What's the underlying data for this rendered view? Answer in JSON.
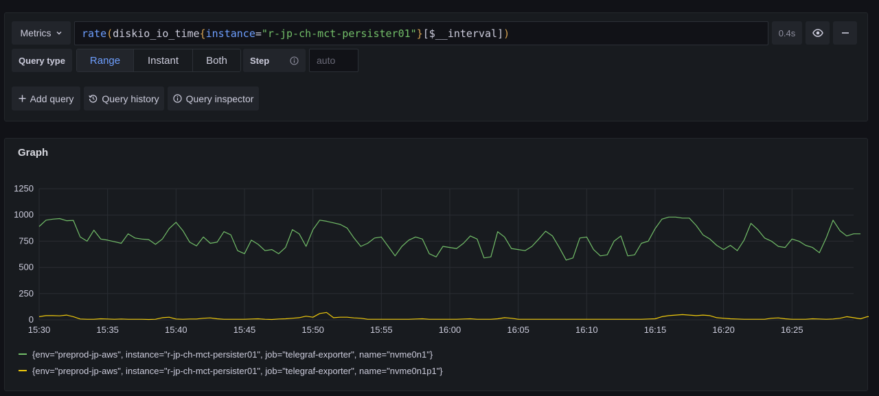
{
  "query": {
    "metrics_label": "Metrics",
    "expression_tokens": [
      {
        "text": "rate",
        "kind": "fn"
      },
      {
        "text": "(",
        "kind": "br"
      },
      {
        "text": "diskio_io_time",
        "kind": "id"
      },
      {
        "text": "{",
        "kind": "br"
      },
      {
        "text": "instance",
        "kind": "label"
      },
      {
        "text": "=",
        "kind": "id"
      },
      {
        "text": "\"r-jp-ch-mct-persister01\"",
        "kind": "str"
      },
      {
        "text": "}",
        "kind": "br"
      },
      {
        "text": "[$__interval]",
        "kind": "id"
      },
      {
        "text": ")",
        "kind": "br"
      }
    ],
    "duration": "0.4s",
    "query_type_label": "Query type",
    "query_types": [
      "Range",
      "Instant",
      "Both"
    ],
    "selected_query_type": "Range",
    "step_label": "Step",
    "step_placeholder": "auto",
    "add_query_label": "Add query",
    "history_label": "Query history",
    "inspector_label": "Query inspector"
  },
  "graph": {
    "title": "Graph"
  },
  "colors": {
    "series_green": "#73bf69",
    "series_yellow": "#f2cc0c",
    "accent_blue": "#6e9fff"
  },
  "chart_data": {
    "type": "line",
    "title": "Graph",
    "x_ticks": [
      "15:30",
      "15:35",
      "15:40",
      "15:45",
      "15:50",
      "15:55",
      "16:00",
      "16:05",
      "16:10",
      "16:15",
      "16:20",
      "16:25"
    ],
    "x_start": "15:30",
    "x_end": "16:29:30",
    "sample_interval_seconds": 30,
    "ylim": [
      0,
      1250
    ],
    "y_ticks": [
      0,
      250,
      500,
      750,
      1000,
      1250
    ],
    "grid": true,
    "legend_position": "bottom",
    "series": [
      {
        "name": "{env=\"preprod-jp-aws\", instance=\"r-jp-ch-mct-persister01\", job=\"telegraf-exporter\", name=\"nvme0n1\"}",
        "color": "#73bf69",
        "values": [
          890,
          950,
          960,
          965,
          945,
          948,
          790,
          750,
          855,
          770,
          760,
          745,
          730,
          820,
          780,
          770,
          765,
          720,
          770,
          870,
          930,
          850,
          740,
          705,
          790,
          730,
          740,
          840,
          810,
          660,
          630,
          760,
          720,
          660,
          670,
          630,
          690,
          860,
          820,
          700,
          860,
          950,
          940,
          925,
          910,
          875,
          780,
          700,
          730,
          780,
          790,
          700,
          610,
          700,
          760,
          790,
          770,
          630,
          600,
          700,
          690,
          680,
          730,
          800,
          770,
          590,
          600,
          840,
          790,
          680,
          670,
          660,
          700,
          770,
          845,
          800,
          690,
          570,
          590,
          780,
          790,
          670,
          610,
          620,
          750,
          800,
          610,
          620,
          730,
          750,
          870,
          960,
          980,
          980,
          970,
          970,
          900,
          810,
          770,
          710,
          670,
          710,
          660,
          760,
          920,
          860,
          780,
          750,
          700,
          690,
          770,
          750,
          710,
          690,
          640,
          780,
          950,
          850,
          800,
          820,
          820
        ]
      },
      {
        "name": "{env=\"preprod-jp-aws\", instance=\"r-jp-ch-mct-persister01\", job=\"telegraf-exporter\", name=\"nvme0n1p1\"}",
        "color": "#f2cc0c",
        "values": [
          30,
          40,
          40,
          38,
          45,
          30,
          8,
          5,
          5,
          10,
          8,
          5,
          8,
          5,
          5,
          5,
          3,
          5,
          20,
          25,
          8,
          5,
          8,
          8,
          15,
          18,
          10,
          5,
          5,
          5,
          5,
          8,
          10,
          5,
          3,
          8,
          10,
          15,
          20,
          35,
          25,
          60,
          70,
          20,
          25,
          25,
          18,
          15,
          5,
          5,
          5,
          5,
          5,
          5,
          5,
          8,
          10,
          5,
          5,
          5,
          5,
          5,
          8,
          10,
          5,
          5,
          5,
          10,
          20,
          15,
          5,
          5,
          5,
          5,
          5,
          5,
          5,
          5,
          5,
          5,
          5,
          5,
          5,
          5,
          5,
          5,
          5,
          5,
          5,
          8,
          10,
          30,
          40,
          45,
          50,
          45,
          40,
          45,
          40,
          20,
          15,
          10,
          8,
          5,
          5,
          5,
          5,
          15,
          18,
          10,
          5,
          5,
          5,
          10,
          8,
          5,
          8,
          15,
          30,
          20,
          10,
          30,
          30
        ]
      }
    ]
  }
}
